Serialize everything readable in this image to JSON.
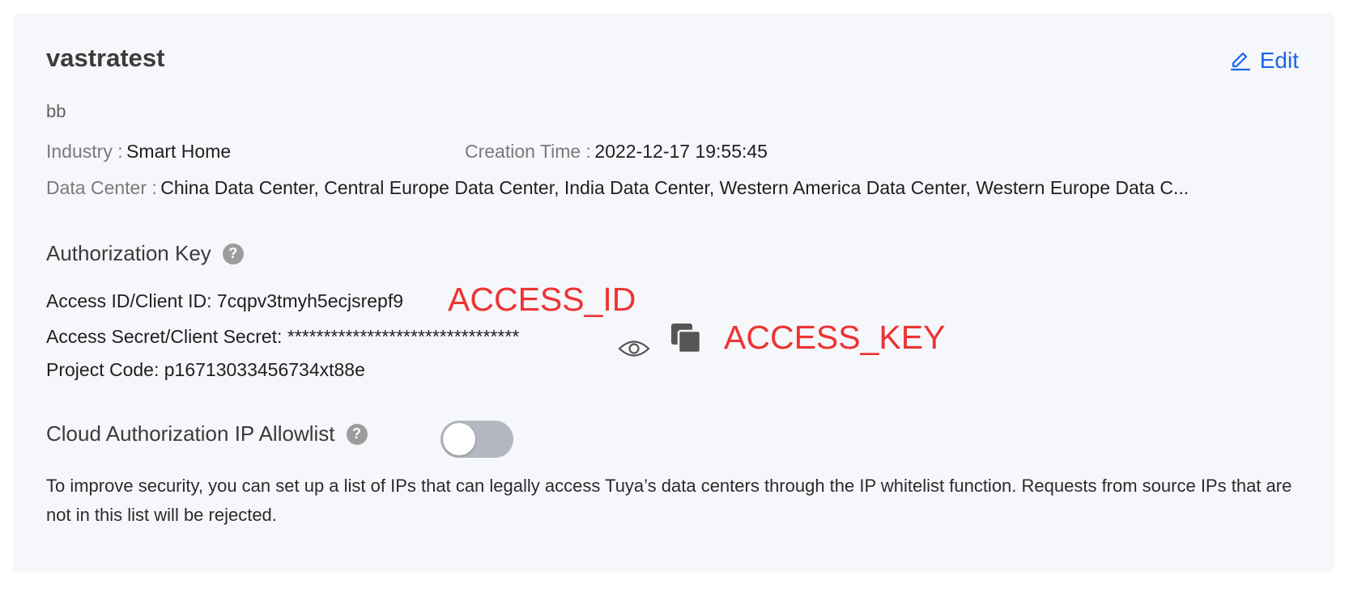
{
  "project": {
    "name": "vastratest",
    "description": "bb",
    "edit_label": "Edit"
  },
  "meta": {
    "industry_label": "Industry :",
    "industry_value": "Smart Home",
    "creation_label": "Creation Time :",
    "creation_value": "2022-12-17 19:55:45",
    "datacenter_label": "Data Center :",
    "datacenter_value": "China Data Center, Central Europe Data Center, India Data Center, Western America Data Center, Western Europe Data C..."
  },
  "authorization": {
    "title": "Authorization Key",
    "help": "?",
    "access_id_label": "Access ID/Client ID:",
    "access_id_value": "7cqpv3tmyh5ecjsrepf9",
    "access_secret_label": "Access Secret/Client Secret:",
    "access_secret_value": "********************************",
    "project_code_label": "Project Code:",
    "project_code_value": "p16713033456734xt88e"
  },
  "annotations": {
    "access_id": "ACCESS_ID",
    "access_key": "ACCESS_KEY"
  },
  "ip_allowlist": {
    "title": "Cloud Authorization IP Allowlist",
    "help": "?",
    "enabled": false,
    "description": "To improve security, you can set up a list of IPs that can legally access Tuya’s data centers through the IP whitelist function. Requests from source IPs that are not in this list will be rejected."
  },
  "icons": {
    "edit": "pencil-icon",
    "show_secret": "eye-icon",
    "copy": "copy-icon",
    "help": "help-icon"
  },
  "colors": {
    "card_background": "#f5f7fb",
    "link": "#1a66e6",
    "annotation": "#ee3333",
    "toggle_off": "#b3b7c0"
  }
}
